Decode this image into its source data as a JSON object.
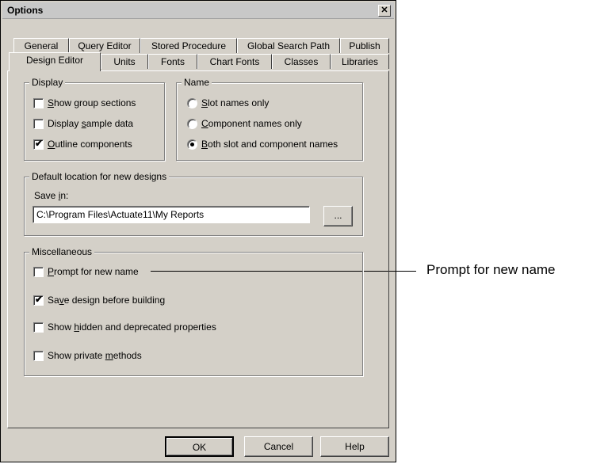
{
  "window": {
    "title": "Options",
    "close_glyph": "✕"
  },
  "tabs": {
    "back_row": [
      "General",
      "Query Editor",
      "Stored Procedure",
      "Global Search Path",
      "Publish"
    ],
    "front_row": [
      "Design Editor",
      "Units",
      "Fonts",
      "Chart Fonts",
      "Classes",
      "Libraries"
    ],
    "active": "Design Editor"
  },
  "display_group": {
    "legend": "Display",
    "options": [
      {
        "pre": "",
        "u": "S",
        "post": "how group sections",
        "checked": false
      },
      {
        "pre": "Display ",
        "u": "s",
        "post": "ample data",
        "checked": false
      },
      {
        "pre": "",
        "u": "O",
        "post": "utline components",
        "checked": true
      }
    ]
  },
  "name_group": {
    "legend": "Name",
    "options": [
      {
        "pre": "",
        "u": "S",
        "post": "lot names only",
        "selected": false
      },
      {
        "pre": "",
        "u": "C",
        "post": "omponent names only",
        "selected": false
      },
      {
        "pre": "",
        "u": "B",
        "post": "oth slot and component names",
        "selected": true
      }
    ]
  },
  "location_group": {
    "legend": "Default location for new designs",
    "save_in": {
      "pre": "Save ",
      "u": "i",
      "post": "n:"
    },
    "path_value": "C:\\Program Files\\Actuate11\\My Reports",
    "browse_label": "..."
  },
  "misc_group": {
    "legend": "Miscellaneous",
    "options": [
      {
        "pre": "",
        "u": "P",
        "post": "rompt for new name",
        "checked": false
      },
      {
        "pre": "Sa",
        "u": "v",
        "post": "e design before building",
        "checked": true
      },
      {
        "pre": "Show ",
        "u": "h",
        "post": "idden and deprecated properties",
        "checked": false
      },
      {
        "pre": "Show private ",
        "u": "m",
        "post": "ethods",
        "checked": false
      }
    ]
  },
  "buttons": {
    "ok": "OK",
    "cancel": "Cancel",
    "help": "Help"
  },
  "callout": {
    "text": "Prompt for new name"
  },
  "check_glyph": "✔"
}
